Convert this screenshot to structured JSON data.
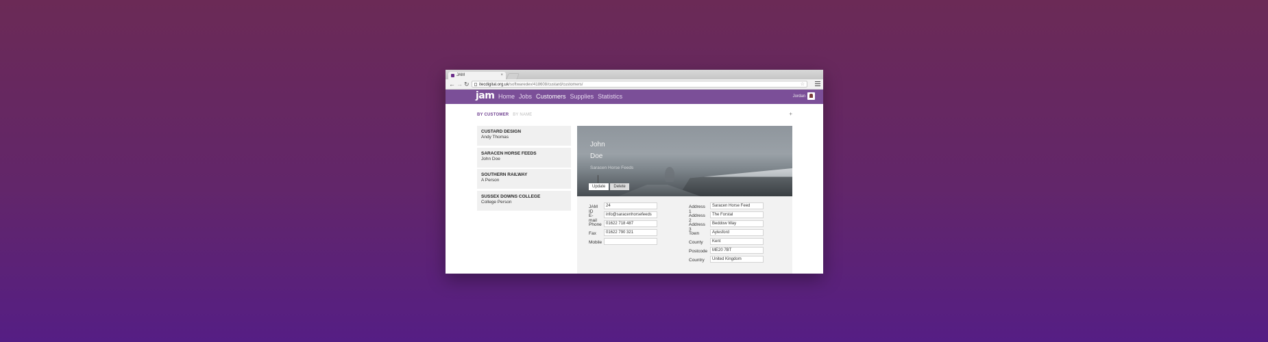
{
  "browser": {
    "tab_title": "JAM",
    "tab_close": "×",
    "url_host": "itecdigital.org.uk",
    "url_path": "/softwaredev/418608/custard/customers/"
  },
  "app": {
    "logo": "jam",
    "nav": [
      "Home",
      "Jobs",
      "Customers",
      "Supplies",
      "Statistics"
    ],
    "active_nav": "Customers",
    "user_name": "Jordan"
  },
  "subnav": {
    "by_customer": "BY CUSTOMER",
    "by_name": "BY NAME",
    "add": "+"
  },
  "customers": [
    {
      "company": "CUSTARD DESIGN",
      "person": "Andy Thomas"
    },
    {
      "company": "SARACEN HORSE FEEDS",
      "person": "John Doe"
    },
    {
      "company": "SOUTHERN RAILWAY",
      "person": "A Person"
    },
    {
      "company": "SUSSEX DOWNS COLLEGE",
      "person": "College Person"
    }
  ],
  "detail": {
    "first_name": "John",
    "last_name": "Doe",
    "company": "Saracen Horse Feeds",
    "update_label": "Update",
    "delete_label": "Delete",
    "left_fields": [
      {
        "label": "JAM ID",
        "value": "24"
      },
      {
        "label": "E-mail",
        "value": "info@saracenhorsefeeds"
      },
      {
        "label": "Phone",
        "value": "01622 718 487"
      },
      {
        "label": "Fax",
        "value": "01622 790 321"
      },
      {
        "label": "Mobile",
        "value": ""
      }
    ],
    "right_labels": [
      "Address 1",
      "Address 2",
      "Address 3",
      "Town",
      "County",
      "Postcode",
      "Country"
    ],
    "right_values": [
      "Saracen Horse Feed",
      "The Forstal",
      "Beddow Way",
      "Aylesford",
      "Kent",
      "ME20 7BT",
      "United Kingdom"
    ]
  }
}
